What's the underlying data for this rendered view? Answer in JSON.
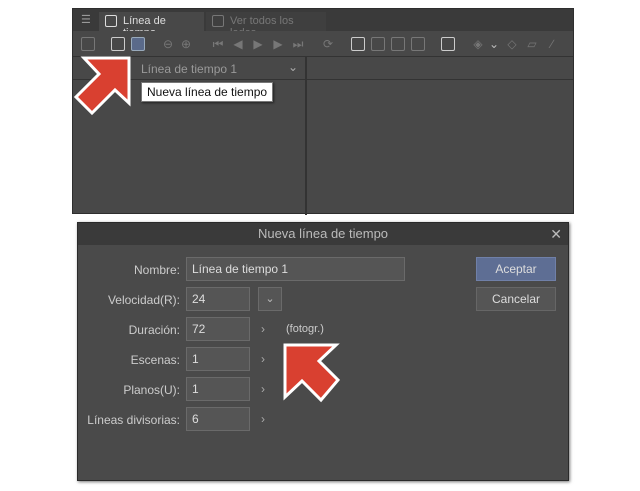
{
  "panel": {
    "menu_icon": "hamburger-icon",
    "tabs": [
      {
        "label": "Línea de tiempo",
        "icon": "timeline-icon"
      },
      {
        "label": "Ver todos los lados",
        "icon": "camera-icon"
      }
    ],
    "timeline_name": "Línea de tiempo 1",
    "tooltip": "Nueva línea de tiempo"
  },
  "dialog": {
    "title": "Nueva línea de tiempo",
    "fields": [
      {
        "label": "Nombre:",
        "value": "Línea de tiempo 1"
      },
      {
        "label": "Velocidad(R):",
        "value": "24"
      },
      {
        "label": "Duración:",
        "value": "72",
        "unit": "(fotogr.)"
      },
      {
        "label": "Escenas:",
        "value": "1"
      },
      {
        "label": "Planos(U):",
        "value": "1"
      },
      {
        "label": "Líneas divisorias:",
        "value": "6"
      }
    ],
    "ok": "Aceptar",
    "cancel": "Cancelar"
  },
  "colors": {
    "accent_arrow": "#d94030",
    "primary_button": "#5e6e94"
  }
}
